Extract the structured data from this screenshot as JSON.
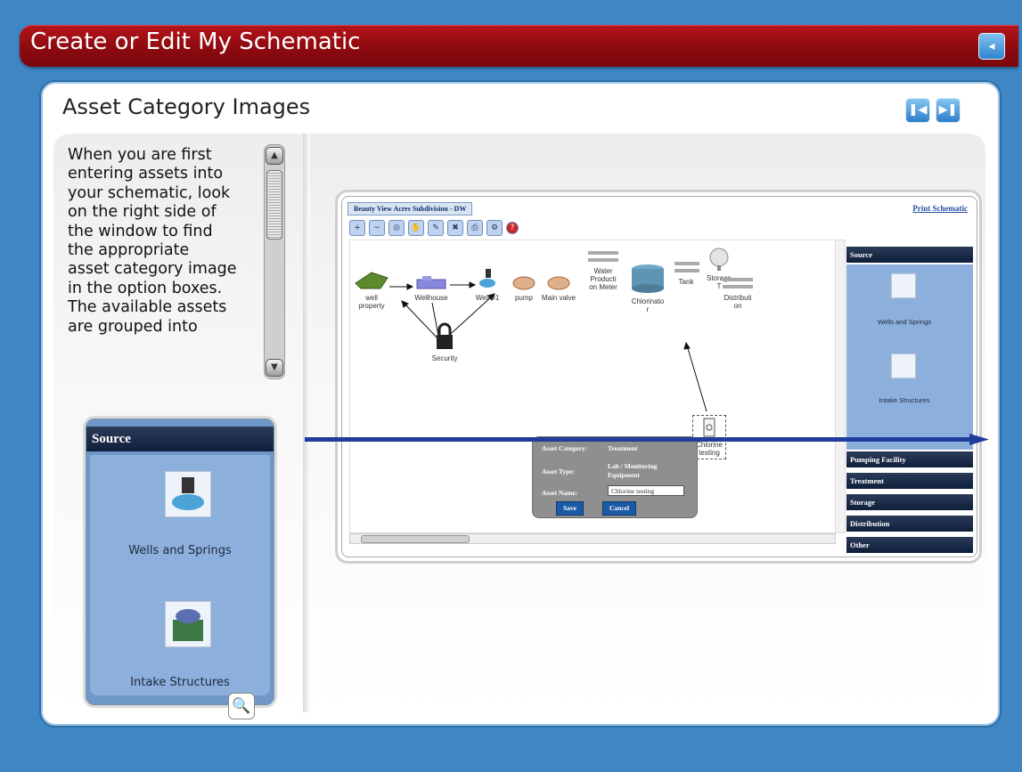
{
  "header": {
    "title": "Create or Edit My Schematic"
  },
  "card": {
    "title": "Asset Category Images"
  },
  "narration": {
    "text_lines": [
      "When you are first",
      "entering assets into",
      "your schematic, look",
      "on the right side of",
      "the window to find",
      "the appropriate",
      "asset category image",
      "in the option boxes.",
      "The available assets",
      "are grouped into"
    ]
  },
  "source_panel": {
    "header": "Source",
    "items": [
      {
        "label": "Wells and Springs",
        "icon": "well-icon"
      },
      {
        "label": "Intake Structures",
        "icon": "intake-icon"
      }
    ]
  },
  "screenshot": {
    "tab": "Beauty View Acres Subdivision - DW",
    "print_link": "Print Schematic",
    "assets": [
      {
        "label1": "well",
        "label2": "property"
      },
      {
        "label1": "Wellhouse",
        "label2": ""
      },
      {
        "label1": "Well #1",
        "label2": ""
      },
      {
        "label1": "pump",
        "label2": ""
      },
      {
        "label1": "Main valve",
        "label2": ""
      },
      {
        "label1": "Water",
        "label2": "Producti",
        "label3": "on Meter"
      },
      {
        "label1": "Chlorinato",
        "label2": "r"
      },
      {
        "label1": "Tank",
        "label2": ""
      },
      {
        "label1": "Storage",
        "label2": "T"
      },
      {
        "label1": "Distributi",
        "label2": "on"
      },
      {
        "label1": "Security",
        "label2": ""
      },
      {
        "label1": "Chlorine",
        "label2": "testing"
      }
    ],
    "dialog": {
      "category_label": "Asset Category:",
      "category_value": "Treatment",
      "type_label": "Asset Type:",
      "type_value_1": "Lab / Monitoring",
      "type_value_2": "Equipment",
      "name_label": "Asset Name:",
      "name_value": "Chlorine testing",
      "save": "Save",
      "cancel": "Cancel"
    },
    "right_panel": {
      "source": "Source",
      "wells": "Wells and Springs",
      "intake": "Intake Structures",
      "categories": [
        "Pumping Facility",
        "Treatment",
        "Storage",
        "Distribution",
        "Other"
      ]
    }
  }
}
